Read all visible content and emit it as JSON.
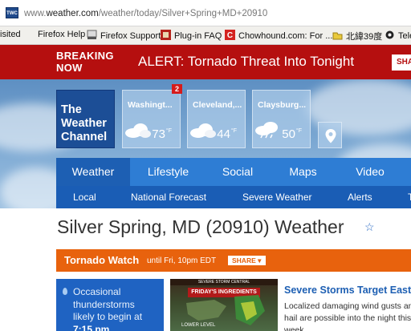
{
  "browser": {
    "favicon_text": "TWC",
    "url_prefix": "www.",
    "url_domain": "weather.com",
    "url_path": "/weather/today/Silver+Spring+MD+20910"
  },
  "bookmarks": [
    {
      "label": "isited"
    },
    {
      "label": "Firefox Help"
    },
    {
      "label": "Firefox Support"
    },
    {
      "label": "Plug-in FAQ"
    },
    {
      "label": "Chowhound.com: For ..."
    },
    {
      "label": "北緯39度"
    },
    {
      "label": "Tele"
    }
  ],
  "breaking": {
    "label_line1": "BREAKING",
    "label_line2": "NOW",
    "alert": "ALERT: Tornado Threat Into Tonight",
    "share": "SHA"
  },
  "logo": {
    "line1": "The",
    "line2": "Weather",
    "line3": "Channel"
  },
  "recent_locations": [
    {
      "city": "Washingt...",
      "temp": "73",
      "unit": "°F",
      "icon": "cloud-icon"
    },
    {
      "city": "Cleveland,...",
      "temp": "44",
      "unit": "°F",
      "icon": "cloud-icon"
    },
    {
      "city": "Claysburg...",
      "temp": "50",
      "unit": "°F",
      "icon": "cloud-icon"
    }
  ],
  "alert_badge": "2",
  "nav": {
    "main": [
      "Weather",
      "Lifestyle",
      "Social",
      "Maps",
      "Video"
    ],
    "sub": [
      "Local",
      "National Forecast",
      "Severe Weather",
      "Alerts",
      "T"
    ]
  },
  "page_title": "Silver Spring, MD (20910) Weather",
  "watch": {
    "title": "Tornado Watch",
    "until": "until Fri, 10pm EDT",
    "share": "SHARE ▾"
  },
  "forecast": {
    "line1": "Occasional",
    "line2": "thunderstorms",
    "line3": "likely to begin at",
    "time": "7:15 pm"
  },
  "video": {
    "header": "SEVERE STORM CENTRAL",
    "subtitle": "FRIDAY'S INGREDIENTS",
    "footer": "LOWER LEVEL"
  },
  "story": {
    "headline": "Severe Storms Target East",
    "body": "Localized damaging wind gusts and hail are possible into the night this week."
  }
}
